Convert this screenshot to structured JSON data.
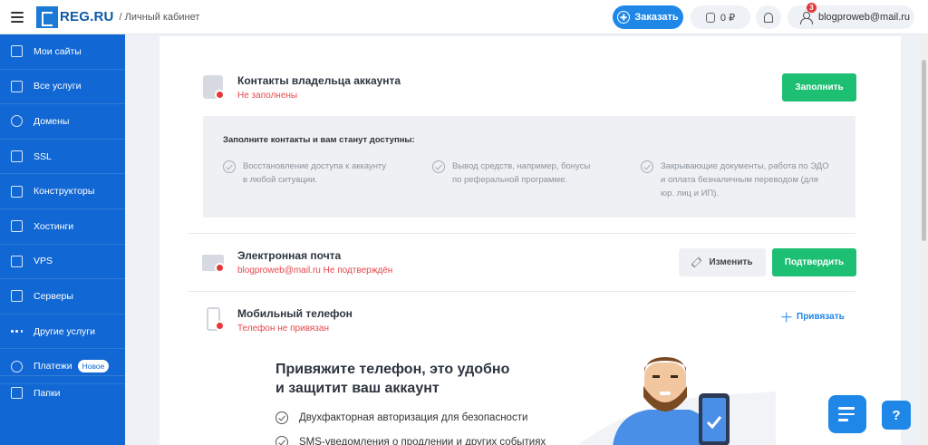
{
  "header": {
    "logo": "REG.RU",
    "subtitle": "/ Личный кабинет",
    "order_label": "Заказать",
    "balance": "0 ₽",
    "notif_count": "3",
    "email": "blogproweb@mail.ru"
  },
  "sidebar": {
    "items": [
      {
        "label": "Мои сайты",
        "icon": "sites-icon"
      },
      {
        "label": "Все услуги",
        "icon": "list-icon"
      },
      {
        "label": "Домены",
        "icon": "globe-icon"
      },
      {
        "label": "SSL",
        "icon": "ssl-icon"
      },
      {
        "label": "Конструкторы",
        "icon": "builder-icon"
      },
      {
        "label": "Хостинги",
        "icon": "hosting-icon"
      },
      {
        "label": "VPS",
        "icon": "vps-icon"
      },
      {
        "label": "Серверы",
        "icon": "server-icon"
      },
      {
        "label": "Другие услуги",
        "icon": "dots-icon"
      },
      {
        "label": "Платежи",
        "icon": "payment-icon",
        "badge": "Новое"
      }
    ],
    "folders_label": "Папки"
  },
  "contacts": {
    "title": "Контакты владельца аккаунта",
    "status": "Не заполнены",
    "fill_label": "Заполнить",
    "info_head": "Заполните контакты и вам станут доступны:",
    "benefits": [
      {
        "line1": "Восстановление доступа к аккаунту",
        "line2": "в любой ситуации.",
        "line3": ""
      },
      {
        "line1": "Вывод средств, например, бонусы",
        "line2": "по реферальной программе.",
        "line3": ""
      },
      {
        "line1": "Закрывающие документы, работа по ЭДО",
        "line2": "и оплата безналичным переводом (для",
        "line3": "юр. лиц и ИП)."
      }
    ]
  },
  "email_section": {
    "title": "Электронная почта",
    "status": "blogproweb@mail.ru Не подтверждён",
    "edit_label": "Изменить",
    "confirm_label": "Подтвердить"
  },
  "phone_section": {
    "title": "Мобильный телефон",
    "status": "Телефон не привязан",
    "link_label": "Привязать"
  },
  "promo": {
    "line1": "Привяжите телефон, это удобно",
    "line2": "и защитит ваш аккаунт",
    "items": [
      "Двухфакторная авторизация для безопасности",
      "SMS-уведомления о продлении и других событиях"
    ]
  },
  "colors": {
    "accent": "#1f87e8",
    "sidebar": "#1167d3",
    "success": "#1dbf73",
    "danger": "#e5373a"
  }
}
